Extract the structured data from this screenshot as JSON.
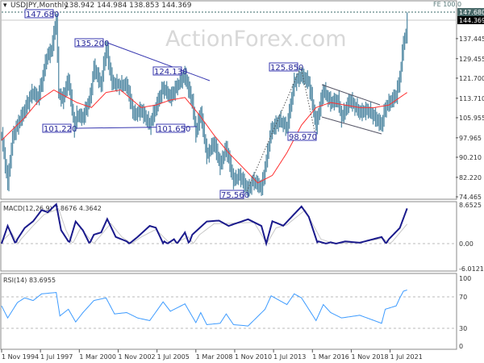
{
  "chart_data": [
    {
      "type": "ohlc",
      "title": "USDJPY,Monthly",
      "ohlc_header": "138.942 144.984 138.853 144.369",
      "symbol": "USDJPY",
      "timeframe": "Monthly",
      "watermark": "ActionForex.com",
      "ylim": [
        74.465,
        147.68
      ],
      "y_ticks": [
        "137.445",
        "129.455",
        "121.700",
        "113.710",
        "105.955",
        "97.965",
        "90.210",
        "82.220",
        "74.465"
      ],
      "y_tick_values": [
        137.445,
        129.455,
        121.7,
        113.71,
        105.955,
        97.965,
        90.21,
        82.22,
        74.465
      ],
      "current_price_label": "144.369",
      "level_label": "147.680",
      "fe_label": "FE 100.0",
      "annotations": [
        "147.680",
        "135.200",
        "124.130",
        "101.220",
        "101.650",
        "125.850",
        "98.970",
        "75.560"
      ],
      "series": [
        {
          "type": "close",
          "color": "#5a8fa8",
          "points": [
            [
              "1994-11",
              99
            ],
            [
              "1995-04",
              80
            ],
            [
              "1995-08",
              98
            ],
            [
              "1995-12",
              103
            ],
            [
              "1996-06",
              109
            ],
            [
              "1996-12",
              116
            ],
            [
              "1997-05",
              114
            ],
            [
              "1997-08",
              120
            ],
            [
              "1997-12",
              130
            ],
            [
              "1998-04",
              133
            ],
            [
              "1998-08",
              145
            ],
            [
              "1998-10",
              116
            ],
            [
              "1999-01",
              113
            ],
            [
              "1999-06",
              121
            ],
            [
              "1999-11",
              102
            ],
            [
              "2000-01",
              107
            ],
            [
              "2000-06",
              106
            ],
            [
              "2000-12",
              114
            ],
            [
              "2001-03",
              126
            ],
            [
              "2001-09",
              119
            ],
            [
              "2002-01",
              134
            ],
            [
              "2002-06",
              120
            ],
            [
              "2002-12",
              119
            ],
            [
              "2003-06",
              119
            ],
            [
              "2003-12",
              107
            ],
            [
              "2004-06",
              109
            ],
            [
              "2005-01",
              103
            ],
            [
              "2005-06",
              110
            ],
            [
              "2005-12",
              118
            ],
            [
              "2006-06",
              114
            ],
            [
              "2006-12",
              119
            ],
            [
              "2007-06",
              123
            ],
            [
              "2007-12",
              112
            ],
            [
              "2008-03",
              100
            ],
            [
              "2008-07",
              108
            ],
            [
              "2008-12",
              91
            ],
            [
              "2009-06",
              96
            ],
            [
              "2009-11",
              87
            ],
            [
              "2010-04",
              94
            ],
            [
              "2010-10",
              81
            ],
            [
              "2011-03",
              83
            ],
            [
              "2011-10",
              77
            ],
            [
              "2012-02",
              81
            ],
            [
              "2012-09",
              78
            ],
            [
              "2012-12",
              86
            ],
            [
              "2013-05",
              101
            ],
            [
              "2013-12",
              105
            ],
            [
              "2014-06",
              102
            ],
            [
              "2014-12",
              120
            ],
            [
              "2015-06",
              123
            ],
            [
              "2015-12",
              120
            ],
            [
              "2016-06",
              103
            ],
            [
              "2016-12",
              117
            ],
            [
              "2017-06",
              112
            ],
            [
              "2017-12",
              113
            ],
            [
              "2018-03",
              106
            ],
            [
              "2018-10",
              113
            ],
            [
              "2019-06",
              108
            ],
            [
              "2019-12",
              109
            ],
            [
              "2020-03",
              108
            ],
            [
              "2020-12",
              103
            ],
            [
              "2021-03",
              110
            ],
            [
              "2021-12",
              115
            ],
            [
              "2022-03",
              122
            ],
            [
              "2022-06",
              136
            ],
            [
              "2022-08",
              139
            ],
            [
              "2022-09",
              144.369
            ]
          ]
        },
        {
          "type": "moving-average",
          "color": "#ff3030",
          "points": [
            [
              "1994-11",
              97
            ],
            [
              "1996-06",
              106
            ],
            [
              "1997-06",
              113
            ],
            [
              "1998-06",
              117
            ],
            [
              "2000-01",
              112
            ],
            [
              "2001-01",
              110
            ],
            [
              "2002-01",
              116
            ],
            [
              "2003-01",
              117
            ],
            [
              "2004-06",
              110
            ],
            [
              "2005-06",
              111
            ],
            [
              "2006-06",
              113
            ],
            [
              "2007-06",
              114
            ],
            [
              "2008-06",
              107
            ],
            [
              "2009-06",
              99
            ],
            [
              "2010-06",
              92
            ],
            [
              "2011-06",
              86
            ],
            [
              "2012-06",
              80
            ],
            [
              "2013-06",
              83
            ],
            [
              "2014-06",
              92
            ],
            [
              "2015-06",
              103
            ],
            [
              "2016-06",
              110
            ],
            [
              "2017-06",
              112
            ],
            [
              "2018-06",
              111
            ],
            [
              "2019-06",
              110
            ],
            [
              "2020-06",
              110
            ],
            [
              "2021-06",
              111
            ],
            [
              "2022-09",
              116
            ]
          ]
        }
      ]
    },
    {
      "type": "line",
      "title": "MACD(12,26,9) 7.8676 4.3642",
      "ylim": [
        -6.0121,
        8.6525
      ],
      "y_ticks": [
        "8.6525",
        "0.00",
        "-6.0121"
      ],
      "series": [
        {
          "type": "macd",
          "color": "#1a1a8c",
          "points": [
            [
              "1994-11",
              0
            ],
            [
              "1995-04",
              -4
            ],
            [
              "1995-12",
              1
            ],
            [
              "1996-06",
              3.5
            ],
            [
              "1997-01",
              5
            ],
            [
              "1997-08",
              7.5
            ],
            [
              "1998-01",
              7
            ],
            [
              "1998-08",
              8.8
            ],
            [
              "1998-12",
              3
            ],
            [
              "1999-06",
              0.5
            ],
            [
              "1999-12",
              -5
            ],
            [
              "2000-06",
              -3
            ],
            [
              "2001-03",
              2
            ],
            [
              "2001-09",
              2.5
            ],
            [
              "2002-02",
              5.5
            ],
            [
              "2002-09",
              1.5
            ],
            [
              "2003-06",
              0.5
            ],
            [
              "2004-03",
              -1.5
            ],
            [
              "2005-01",
              -4
            ],
            [
              "2005-06",
              -3.6
            ],
            [
              "2006-01",
              0.5
            ],
            [
              "2006-09",
              -1
            ],
            [
              "2007-06",
              2.5
            ],
            [
              "2007-12",
              -2
            ],
            [
              "2008-12",
              -5
            ],
            [
              "2009-10",
              -5.2
            ],
            [
              "2010-06",
              -4
            ],
            [
              "2011-10",
              -5.5
            ],
            [
              "2012-09",
              -4
            ],
            [
              "2013-06",
              5
            ],
            [
              "2014-03",
              4
            ],
            [
              "2015-06",
              8.3
            ],
            [
              "2015-12",
              6
            ],
            [
              "2016-08",
              -0.5
            ],
            [
              "2017-06",
              0.3
            ],
            [
              "2018-06",
              -0.5
            ],
            [
              "2019-06",
              -0.2
            ],
            [
              "2020-12",
              -1.5
            ],
            [
              "2021-06",
              1
            ],
            [
              "2022-03",
              3.5
            ],
            [
              "2022-09",
              7.8676
            ]
          ]
        },
        {
          "type": "signal",
          "color": "#c8c8c8",
          "points": [
            [
              "1994-11",
              -0.5
            ],
            [
              "1995-07",
              -2.5
            ],
            [
              "1996-03",
              1
            ],
            [
              "1997-01",
              4
            ],
            [
              "1997-10",
              6.5
            ],
            [
              "1998-10",
              7.8
            ],
            [
              "1999-04",
              3
            ],
            [
              "2000-04",
              -3.5
            ],
            [
              "2001-06",
              1
            ],
            [
              "2002-05",
              4.5
            ],
            [
              "2003-02",
              1.5
            ],
            [
              "2004-06",
              -1.5
            ],
            [
              "2005-06",
              -3.2
            ],
            [
              "2006-04",
              -0.5
            ],
            [
              "2007-09",
              1.5
            ],
            [
              "2008-06",
              -2
            ],
            [
              "2009-06",
              -4.5
            ],
            [
              "2010-10",
              -4.6
            ],
            [
              "2012-03",
              -4.8
            ],
            [
              "2013-09",
              3.5
            ],
            [
              "2014-06",
              4.2
            ],
            [
              "2015-09",
              7.5
            ],
            [
              "2016-10",
              1
            ],
            [
              "2017-09",
              0
            ],
            [
              "2019-06",
              -0.3
            ],
            [
              "2021-01",
              -1.2
            ],
            [
              "2021-09",
              0.5
            ],
            [
              "2022-09",
              4.3642
            ]
          ]
        }
      ]
    },
    {
      "type": "line",
      "title": "RSI(14) 83.6955",
      "ylim": [
        0,
        100
      ],
      "y_ticks": [
        "100",
        "70",
        "30",
        "0"
      ],
      "series": [
        {
          "type": "rsi",
          "color": "#3d9bff",
          "points": [
            [
              "1994-11",
              60
            ],
            [
              "1995-04",
              42
            ],
            [
              "1995-12",
              65
            ],
            [
              "1996-06",
              72
            ],
            [
              "1997-01",
              68
            ],
            [
              "1997-08",
              78
            ],
            [
              "1998-08",
              80
            ],
            [
              "1998-11",
              45
            ],
            [
              "1999-06",
              55
            ],
            [
              "1999-12",
              36
            ],
            [
              "2000-06",
              50
            ],
            [
              "2001-03",
              68
            ],
            [
              "2002-01",
              72
            ],
            [
              "2002-08",
              48
            ],
            [
              "2003-06",
              50
            ],
            [
              "2004-03",
              42
            ],
            [
              "2005-01",
              38
            ],
            [
              "2005-12",
              66
            ],
            [
              "2006-06",
              52
            ],
            [
              "2007-06",
              63
            ],
            [
              "2008-03",
              35
            ],
            [
              "2008-07",
              50
            ],
            [
              "2008-12",
              32
            ],
            [
              "2009-11",
              34
            ],
            [
              "2010-04",
              48
            ],
            [
              "2010-10",
              32
            ],
            [
              "2011-10",
              30
            ],
            [
              "2012-12",
              55
            ],
            [
              "2013-05",
              75
            ],
            [
              "2014-06",
              62
            ],
            [
              "2014-12",
              78
            ],
            [
              "2015-06",
              72
            ],
            [
              "2016-06",
              38
            ],
            [
              "2016-12",
              62
            ],
            [
              "2017-06",
              50
            ],
            [
              "2018-03",
              42
            ],
            [
              "2019-06",
              46
            ],
            [
              "2020-12",
              34
            ],
            [
              "2021-03",
              55
            ],
            [
              "2021-12",
              60
            ],
            [
              "2022-03",
              72
            ],
            [
              "2022-06",
              82
            ],
            [
              "2022-09",
              83.6955
            ]
          ]
        }
      ]
    }
  ],
  "x_ticks": [
    "1 Nov 1994",
    "1 Jul 1997",
    "1 Mar 2000",
    "1 Nov 2002",
    "1 Jul 2005",
    "1 Mar 2008",
    "1 Nov 2010",
    "1 Jul 2013",
    "1 Mar 2016",
    "1 Nov 2018",
    "1 Jul 2021"
  ],
  "x_tick_dates": [
    "1994-11",
    "1997-07",
    "2000-03",
    "2002-11",
    "2005-07",
    "2008-03",
    "2010-11",
    "2013-07",
    "2016-03",
    "2018-11",
    "2021-07"
  ]
}
